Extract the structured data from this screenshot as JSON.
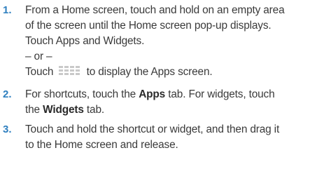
{
  "steps": [
    {
      "number": "1.",
      "lines": [
        "From a Home screen, touch and hold on an empty area",
        "of the screen until the Home screen pop-up displays.",
        "Touch Apps and Widgets."
      ],
      "or_text": "– or –",
      "icon_line_before": "Touch",
      "icon_line_after": "to display the Apps screen.",
      "icon": "apps-grid-icon"
    },
    {
      "number": "2.",
      "line1_before": "For shortcuts, touch the",
      "line1_bold": "Apps",
      "line1_after": "tab. For widgets, touch",
      "line2_before": "the",
      "line2_bold": "Widgets",
      "line2_after": "tab."
    },
    {
      "number": "3.",
      "lines": [
        "Touch and hold the shortcut or widget, and then drag it",
        "to the Home screen and release."
      ]
    }
  ]
}
